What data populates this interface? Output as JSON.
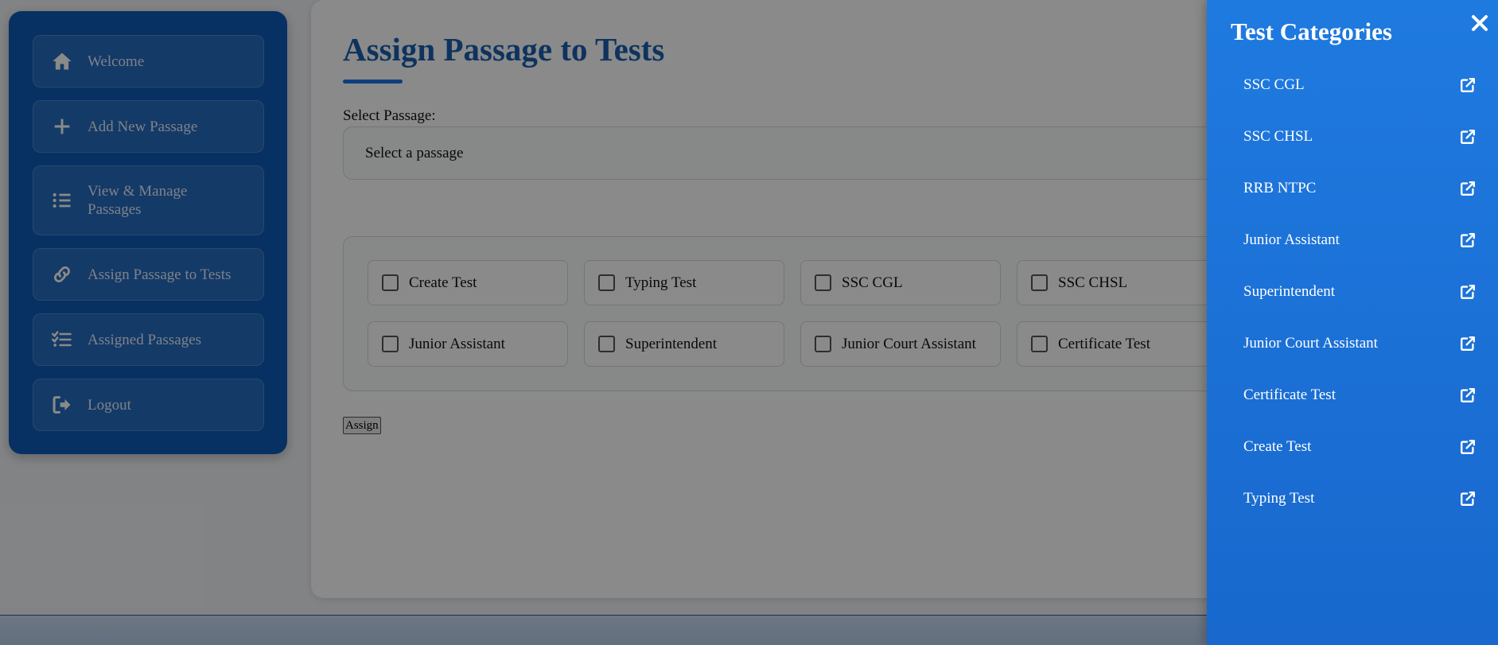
{
  "sidebar": {
    "items": [
      {
        "label": "Welcome",
        "icon": "home-icon"
      },
      {
        "label": "Add New Passage",
        "icon": "plus-icon"
      },
      {
        "label": "View & Manage Passages",
        "icon": "list-icon"
      },
      {
        "label": "Assign Passage to Tests",
        "icon": "link-icon"
      },
      {
        "label": "Assigned Passages",
        "icon": "checklist-icon"
      },
      {
        "label": "Logout",
        "icon": "logout-icon"
      }
    ]
  },
  "main": {
    "title": "Assign Passage to Tests",
    "select_label": "Select Passage:",
    "select_value": "Select a passage",
    "checkboxes": [
      "Create Test",
      "Typing Test",
      "SSC CGL",
      "SSC CHSL",
      "Junior Assistant",
      "Superintendent",
      "Junior Court Assistant",
      "Certificate Test"
    ],
    "assign_label": "Assign"
  },
  "drawer": {
    "title": "Test Categories",
    "close_icon": "close-icon",
    "items": [
      "SSC CGL",
      "SSC CHSL",
      "RRB NTPC",
      "Junior Assistant",
      "Superintendent",
      "Junior Court Assistant",
      "Certificate Test",
      "Create Test",
      "Typing Test"
    ],
    "item_icon": "external-link-icon"
  },
  "colors": {
    "sidebar_bg": "#0d5bb8",
    "title_blue": "#1a5fb0",
    "drawer_bg": "#1f7ae0",
    "overlay": "rgba(0,0,0,0.46)"
  }
}
